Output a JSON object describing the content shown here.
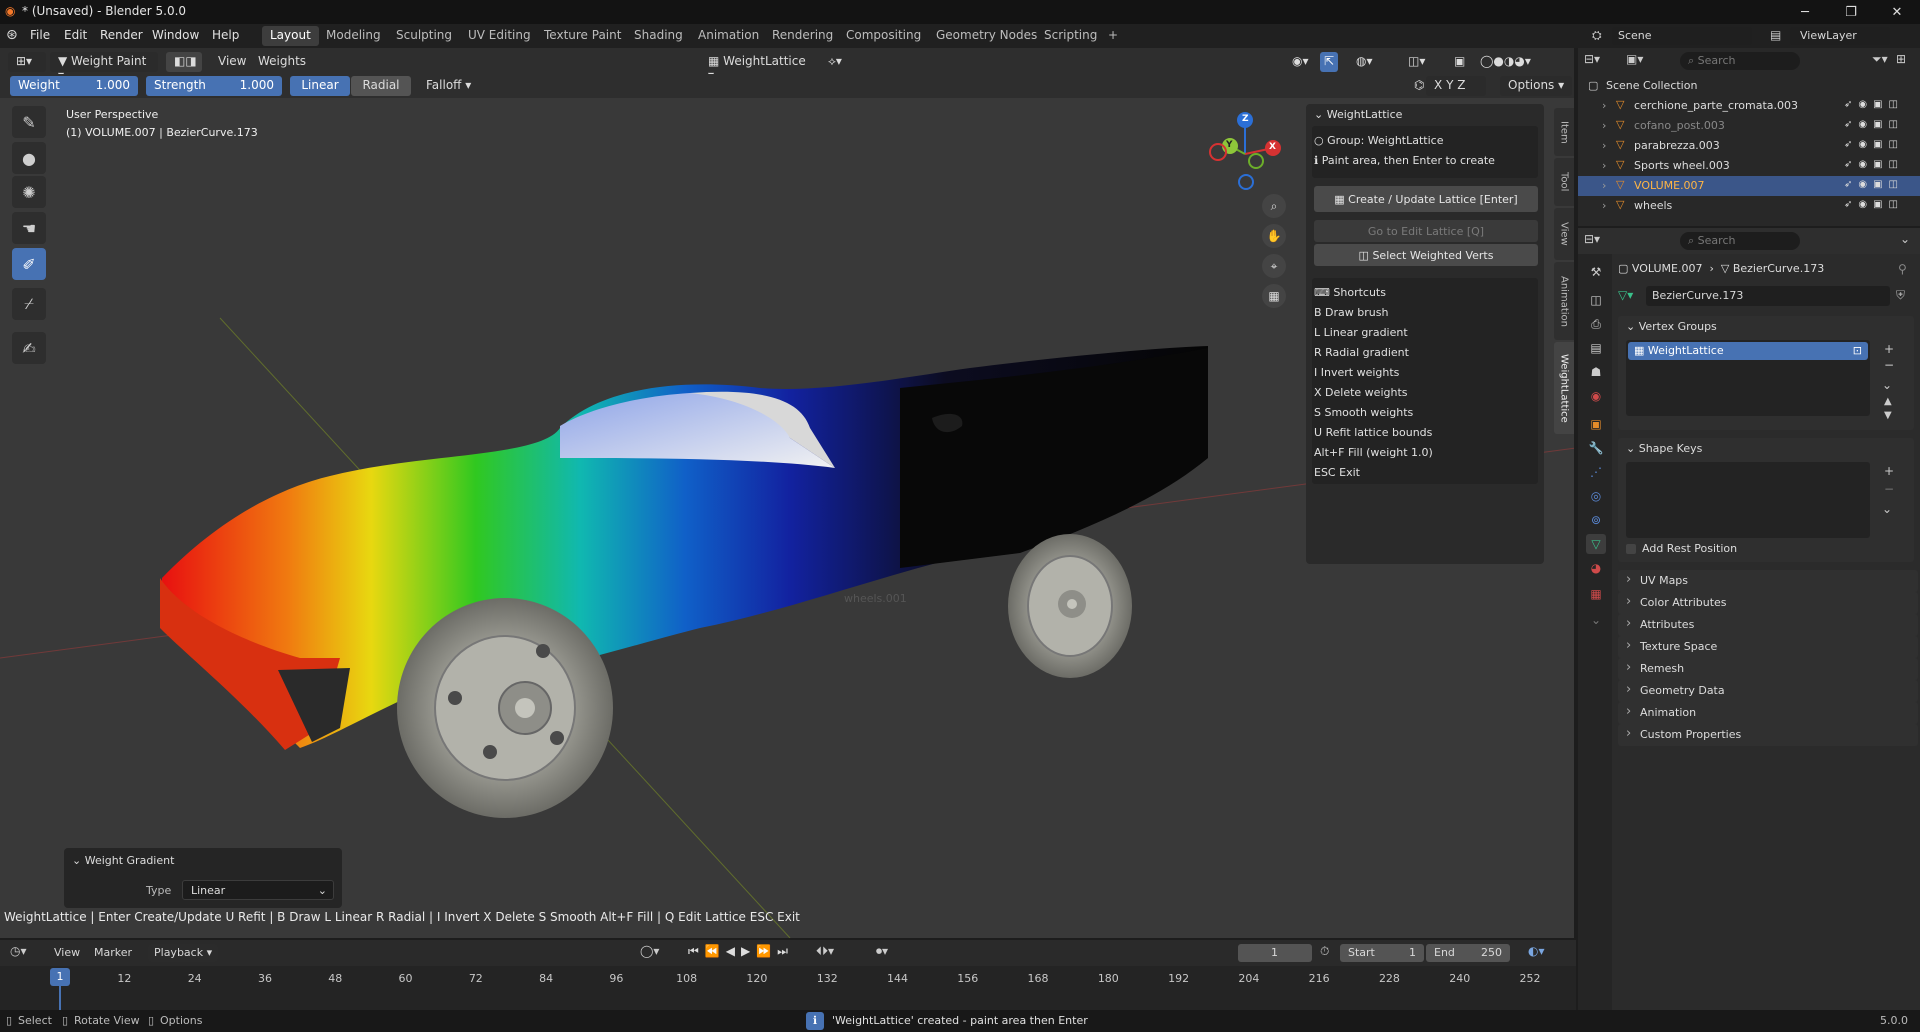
{
  "window": {
    "title": "* (Unsaved) - Blender 5.0.0",
    "controls": [
      "─",
      "❐",
      "✕"
    ]
  },
  "menu": {
    "items": [
      "File",
      "Edit",
      "Render",
      "Window",
      "Help"
    ],
    "workspaces": [
      "Layout",
      "Modeling",
      "Sculpting",
      "UV Editing",
      "Texture Paint",
      "Shading",
      "Animation",
      "Rendering",
      "Compositing",
      "Geometry Nodes",
      "Scripting"
    ],
    "active_workspace": "Layout",
    "add_tab": "+",
    "scene_label": "Scene",
    "viewlayer_label": "ViewLayer"
  },
  "viewport_header": {
    "mode": "Weight Paint",
    "view": "View",
    "weights": "Weights",
    "object_name": "WeightLattice",
    "options": "Options",
    "axes": [
      "X",
      "Y",
      "Z"
    ]
  },
  "tool_settings": {
    "weight_label": "Weight",
    "weight_value": "1.000",
    "strength_label": "Strength",
    "strength_value": "1.000",
    "linear": "Linear",
    "radial": "Radial",
    "falloff": "Falloff"
  },
  "viewport_info": {
    "line1": "User Perspective",
    "line2": "(1) VOLUME.007 | BezierCurve.173",
    "ghost_label": "wheels.001"
  },
  "npanel": {
    "header": "WeightLattice",
    "group_line": "Group: WeightLattice",
    "info_line": "Paint area, then Enter to create",
    "btn_create": "Create / Update Lattice  [Enter]",
    "btn_goto": "Go to Edit Lattice  [Q]",
    "btn_select": "Select Weighted Verts",
    "shortcuts_header": "Shortcuts",
    "shortcuts": [
      {
        "key": "B",
        "desc": "Draw brush"
      },
      {
        "key": "L",
        "desc": "Linear gradient"
      },
      {
        "key": "R",
        "desc": "Radial gradient"
      },
      {
        "key": "I",
        "desc": "Invert weights"
      },
      {
        "key": "X",
        "desc": "Delete weights"
      },
      {
        "key": "S",
        "desc": "Smooth weights"
      },
      {
        "key": "U",
        "desc": "Refit lattice bounds"
      },
      {
        "key": "Alt+F",
        "desc": "Fill (weight 1.0)"
      },
      {
        "key": "ESC",
        "desc": "Exit"
      }
    ],
    "tabs": [
      "Item",
      "Tool",
      "View",
      "Animation",
      "WeightLattice"
    ],
    "active_tab": "WeightLattice"
  },
  "gradient_panel": {
    "title": "Weight Gradient",
    "type_label": "Type",
    "type_value": "Linear"
  },
  "hint_bar": "WeightLattice | Enter Create/Update  U Refit  |  B Draw  L Linear  R Radial  |  I Invert  X Delete  S Smooth  Alt+F Fill  |  Q Edit Lattice  ESC Exit",
  "timeline": {
    "view": "View",
    "marker": "Marker",
    "playback": "Playback",
    "current_frame": "1",
    "start_label": "Start",
    "start_value": "1",
    "end_label": "End",
    "end_value": "250",
    "ticks": [
      "1",
      "12",
      "24",
      "36",
      "48",
      "60",
      "72",
      "84",
      "96",
      "108",
      "120",
      "132",
      "144",
      "156",
      "168",
      "180",
      "192",
      "204",
      "216",
      "228",
      "240",
      "252"
    ]
  },
  "status": {
    "select": "Select",
    "rotate": "Rotate View",
    "options": "Options",
    "message": "'WeightLattice' created - paint area then Enter",
    "version": "5.0.0"
  },
  "outliner": {
    "search_placeholder": "Search",
    "collection": "Scene Collection",
    "items": [
      {
        "name": "cerchione_parte_cromata.003",
        "selected": false,
        "dim": false
      },
      {
        "name": "cofano_post.003",
        "selected": false,
        "dim": true
      },
      {
        "name": "parabrezza.003",
        "selected": false,
        "dim": false
      },
      {
        "name": "Sports wheel.003",
        "selected": false,
        "dim": false
      },
      {
        "name": "VOLUME.007",
        "selected": true,
        "dim": false
      },
      {
        "name": "wheels",
        "selected": false,
        "dim": false
      }
    ]
  },
  "properties": {
    "search_placeholder": "Search",
    "breadcrumb_object": "VOLUME.007",
    "breadcrumb_data": "BezierCurve.173",
    "data_name": "BezierCurve.173",
    "vertex_groups_title": "Vertex Groups",
    "vertex_group_item": "WeightLattice",
    "shape_keys_title": "Shape Keys",
    "add_rest_position": "Add Rest Position",
    "sections": [
      "UV Maps",
      "Color Attributes",
      "Attributes",
      "Texture Space",
      "Remesh",
      "Geometry Data",
      "Animation",
      "Custom Properties"
    ]
  },
  "colors": {
    "accent": "#4772b3",
    "viewport_bg": "#393939",
    "selected_row": "#3b5689"
  }
}
